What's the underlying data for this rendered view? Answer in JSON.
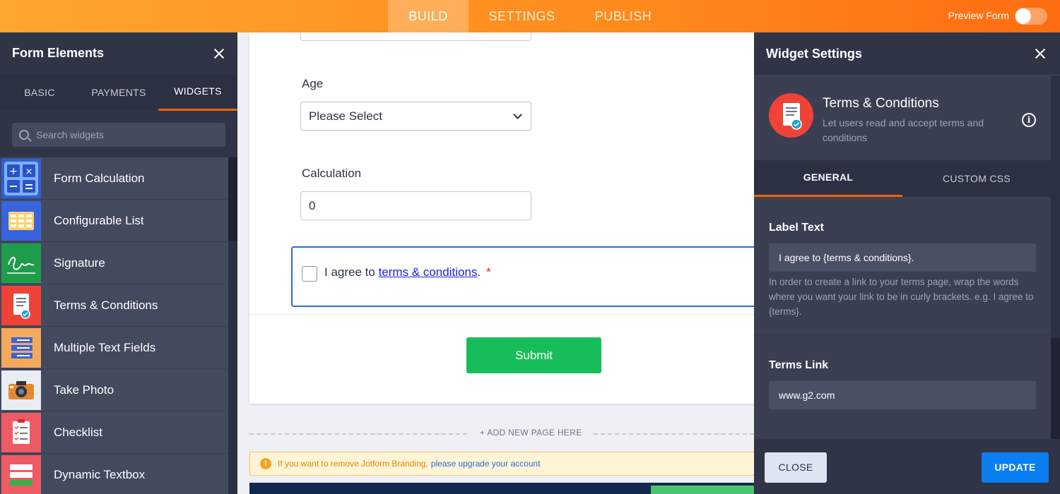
{
  "topbar": {
    "tabs": [
      {
        "label": "BUILD",
        "active": true
      },
      {
        "label": "SETTINGS",
        "active": false
      },
      {
        "label": "PUBLISH",
        "active": false
      }
    ],
    "preview_label": "Preview Form",
    "preview_on": false
  },
  "left_panel": {
    "title": "Form Elements",
    "tabs": [
      {
        "label": "BASIC",
        "active": false
      },
      {
        "label": "PAYMENTS",
        "active": false
      },
      {
        "label": "WIDGETS",
        "active": true
      }
    ],
    "search_placeholder": "Search widgets",
    "widgets": [
      {
        "label": "Form Calculation",
        "icon": "calculator-icon"
      },
      {
        "label": "Configurable List",
        "icon": "list-grid-icon"
      },
      {
        "label": "Signature",
        "icon": "signature-icon"
      },
      {
        "label": "Terms & Conditions",
        "icon": "document-check-icon"
      },
      {
        "label": "Multiple Text Fields",
        "icon": "text-fields-icon"
      },
      {
        "label": "Take Photo",
        "icon": "camera-icon"
      },
      {
        "label": "Checklist",
        "icon": "checklist-icon"
      },
      {
        "label": "Dynamic Textbox",
        "icon": "textbox-icon"
      }
    ]
  },
  "form": {
    "age_label": "Age",
    "age_value": "Please Select",
    "calc_label": "Calculation",
    "calc_value": "0",
    "terms_prefix": "I agree to ",
    "terms_link": "terms & conditions",
    "terms_suffix": ".",
    "required_mark": "*",
    "submit_label": "Submit",
    "add_page": "+ ADD NEW PAGE HERE",
    "branding_text": "If you want to remove Jotform Branding,",
    "branding_link": "please upgrade your account"
  },
  "right_panel": {
    "title": "Widget Settings",
    "widget_title": "Terms & Conditions",
    "widget_desc": "Let users read and accept terms and conditions",
    "tabs": [
      {
        "label": "GENERAL",
        "active": true
      },
      {
        "label": "CUSTOM CSS",
        "active": false
      }
    ],
    "label_text_label": "Label Text",
    "label_text_value": "I agree to {terms & conditions}.",
    "label_help": "In order to create a link to your terms page, wrap the words where you want your link to be in curly brackets. e.g. I agree to {terms}.",
    "terms_link_label": "Terms Link",
    "terms_link_value": "www.g2.com",
    "close_label": "CLOSE",
    "update_label": "UPDATE"
  },
  "colors": {
    "accent": "#ff6100",
    "submit": "#18bd5b",
    "update": "#0b7ef2",
    "link": "#1a20d8"
  }
}
